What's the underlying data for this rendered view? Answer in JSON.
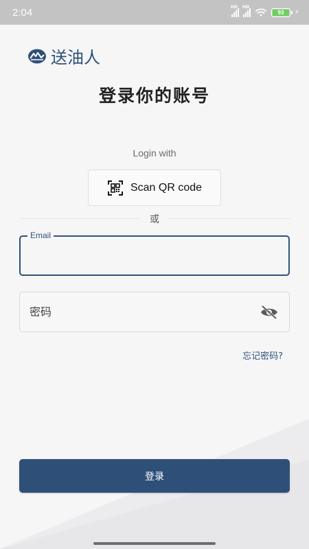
{
  "status_bar": {
    "time": "2:04",
    "network_label": "HD",
    "battery_level": "93"
  },
  "brand": {
    "name": "送油人",
    "logo_icon": "mountain-logo-icon",
    "color": "#2f5179"
  },
  "page": {
    "title": "登录你的账号"
  },
  "login_with": {
    "label": "Login with",
    "qr_button_label": "Scan QR code",
    "qr_icon": "qr-code-icon"
  },
  "divider": {
    "or_text": "或"
  },
  "form": {
    "email": {
      "label": "Email",
      "value": ""
    },
    "password": {
      "placeholder": "密码",
      "value": "",
      "toggle_icon": "eye-off-icon"
    },
    "forgot_label": "忘记密码?",
    "submit_label": "登录"
  },
  "colors": {
    "primary": "#2e5078",
    "background": "#f6f6f7",
    "status_bar": "#c3c3c3",
    "battery": "#6cd15a"
  }
}
